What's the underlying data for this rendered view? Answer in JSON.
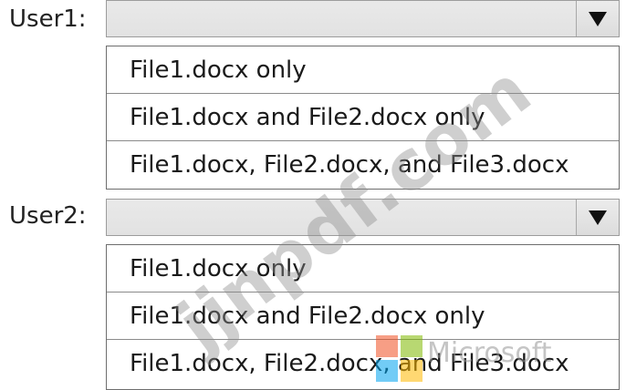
{
  "users": [
    {
      "label": "User1:",
      "selected": "",
      "options": [
        "File1.docx only",
        "File1.docx and File2.docx only",
        "File1.docx, File2.docx, and File3.docx"
      ]
    },
    {
      "label": "User2:",
      "selected": "",
      "options": [
        "File1.docx only",
        "File1.docx and File2.docx only",
        "File1.docx, File2.docx, and File3.docx"
      ]
    }
  ],
  "icons": {
    "dropdown_arrow": "triangle-down-icon"
  },
  "watermark": {
    "site_text": "jjnpdf.com",
    "brand_text": "Microsoft"
  }
}
